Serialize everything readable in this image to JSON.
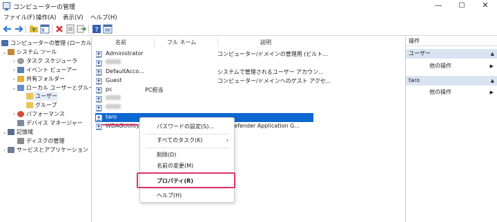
{
  "window": {
    "title": "コンピューターの管理",
    "controls": {
      "minimize": "—",
      "maximize": "▢",
      "close": "✕"
    }
  },
  "menu": [
    "ファイル(F)",
    "操作(A)",
    "表示(V)",
    "ヘルプ(H)"
  ],
  "toolbar_icons": [
    "back-arrow-icon",
    "forward-arrow-icon",
    "folder-up-icon",
    "show-hide-tree-icon",
    "delete-icon",
    "properties-icon",
    "export-icon",
    "help-icon",
    "console-icon"
  ],
  "tree": {
    "root": "コンピューターの管理 (ローカル)",
    "items": [
      {
        "label": "システム ツール",
        "arrow": "⌄",
        "level": 1
      },
      {
        "label": "タスク スケジューラ",
        "arrow": "›",
        "level": 2
      },
      {
        "label": "イベント ビューアー",
        "arrow": "›",
        "level": 2
      },
      {
        "label": "共有フォルダー",
        "arrow": "›",
        "level": 2
      },
      {
        "label": "ローカル ユーザーとグループ",
        "arrow": "⌄",
        "level": 2
      },
      {
        "label": "ユーザー",
        "arrow": "",
        "level": 3
      },
      {
        "label": "グループ",
        "arrow": "",
        "level": 3
      },
      {
        "label": "パフォーマンス",
        "arrow": "›",
        "level": 2
      },
      {
        "label": "デバイス マネージャー",
        "arrow": "",
        "level": 2
      },
      {
        "label": "記憶域",
        "arrow": "⌄",
        "level": 1
      },
      {
        "label": "ディスクの管理",
        "arrow": "",
        "level": 2
      },
      {
        "label": "サービスとアプリケーション",
        "arrow": "›",
        "level": 1
      }
    ]
  },
  "list": {
    "columns": [
      "名前",
      "フル ネーム",
      "説明"
    ],
    "rows": [
      {
        "name": "Administrator",
        "full": "",
        "desc": "コンピューター/ドメインの管理用 (ビルト..."
      },
      {
        "name": "",
        "full": "",
        "desc": ""
      },
      {
        "name": "DefaultAcco...",
        "full": "",
        "desc": "システムで管理されるユーザー アカウン..."
      },
      {
        "name": "Guest",
        "full": "",
        "desc": "コンピューター/ドメインへのゲスト アクセ..."
      },
      {
        "name": "pc",
        "full": "PC担当",
        "desc": ""
      },
      {
        "name": "",
        "full": "",
        "desc": ""
      },
      {
        "name": "",
        "full": "",
        "desc": ""
      },
      {
        "name": "taro",
        "full": "",
        "desc": ""
      },
      {
        "name": "WDAGUtility...",
        "full": "",
        "desc": "ows Defender Application G..."
      }
    ]
  },
  "context_menu": {
    "items": [
      "パスワードの設定(S)...",
      "すべてのタスク(K)",
      "削除(D)",
      "名前の変更(M)",
      "プロパティ(R)",
      "ヘルプ(H)"
    ],
    "submenu_arrow": "›"
  },
  "actions": {
    "header": "操作",
    "sections": [
      {
        "title": "ユーザー",
        "item": "他の操作"
      },
      {
        "title": "taro",
        "item": "他の操作"
      }
    ],
    "caret": "▲",
    "arrow": "▶"
  },
  "colors": {
    "selection": "#0c67d1",
    "highlight_box": "#e0306f",
    "action_section_bg": "#d9e4f2"
  }
}
